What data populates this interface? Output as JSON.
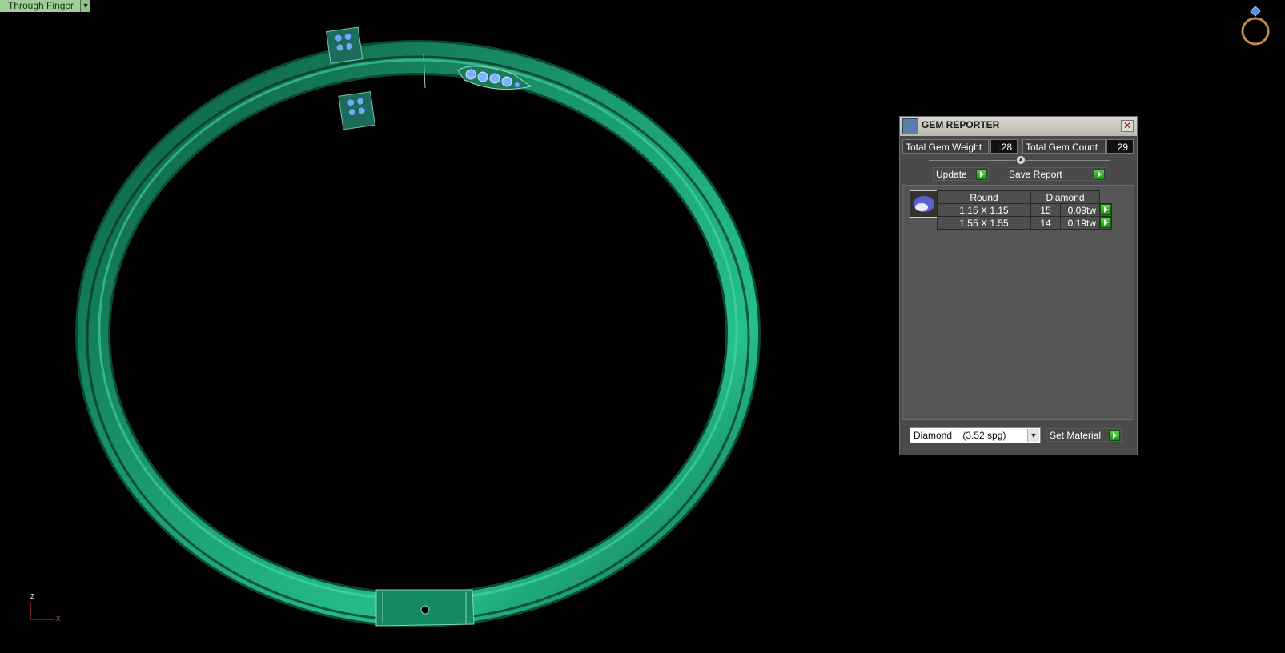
{
  "viewport": {
    "view_mode": "Through Finger",
    "axis_labels": {
      "z": "Z",
      "x": "X"
    },
    "colors": {
      "background": "#000000",
      "ring_metal": "#1a9a6e",
      "gem": "#6fa8ff"
    }
  },
  "gem_reporter": {
    "title": "GEM REPORTER",
    "total_weight_label": "Total Gem Weight",
    "total_weight_value": ".28",
    "total_count_label": "Total Gem Count",
    "total_count_value": "29",
    "update_label": "Update",
    "save_report_label": "Save Report",
    "shape_header": "Round",
    "material_header": "Diamond",
    "rows": [
      {
        "size": "1.15 X 1.15",
        "count": "15",
        "weight": "0.09tw"
      },
      {
        "size": "1.55 X 1.55",
        "count": "14",
        "weight": "0.19tw"
      }
    ],
    "material_select": "Diamond    (3.52 spg)",
    "set_material_label": "Set Material"
  }
}
